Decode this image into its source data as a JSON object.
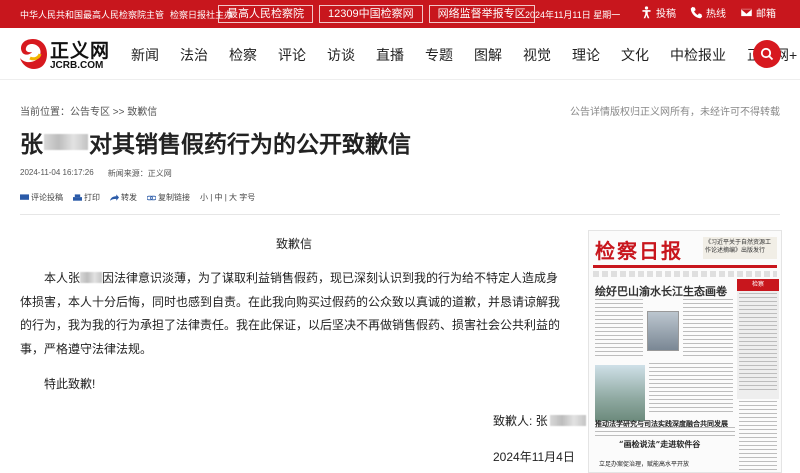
{
  "topbar": {
    "sponsor": "中华人民共和国最高人民检察院主管",
    "publisher": "检察日报社主办",
    "links": [
      "最高人民检察院",
      "12309中国检察网",
      "网络监督举报专区"
    ],
    "date": "2024年11月11日 星期一",
    "actions": [
      {
        "label": "投稿",
        "icon": "accessibility-icon"
      },
      {
        "label": "热线",
        "icon": "phone-icon"
      },
      {
        "label": "邮箱",
        "icon": "mail-icon"
      }
    ]
  },
  "logo": {
    "name": "正义网",
    "domain": "JCRB.COM"
  },
  "nav": [
    "新闻",
    "法治",
    "检察",
    "评论",
    "访谈",
    "直播",
    "专题",
    "图解",
    "视觉",
    "理论",
    "文化",
    "中检报业",
    "正义网+"
  ],
  "article": {
    "breadcrumb": "当前位置：公告专区 >> 致歉信",
    "copyright": "公告详情版权归正义网所有，未经许可不得转载",
    "title_prefix": "张",
    "title_suffix": "对其销售假药行为的公开致歉信",
    "time": "2024-11-04 16:17:26",
    "source": "新闻来源：正义网",
    "tools": [
      "评论投稿",
      "打印",
      "转发",
      "复制链接"
    ],
    "font_size_label": "小 | 中 | 大 字号"
  },
  "letter": {
    "heading": "致歉信",
    "body_start": "本人张",
    "body_rest": "因法律意识淡薄，为了谋取利益销售假药，现已深刻认识到我的行为给不特定人造成身体损害，本人十分后悔，同时也感到自责。在此我向购买过假药的公众致以真诚的道歉，并恳请谅解我的行为，我为我的行为承担了法律责任。我在此保证，以后坚决不再做销售假药、损害社会公共利益的事，严格遵守法律法规。",
    "closing": "特此致歉!",
    "signature": "致歉人: 张",
    "date": "2024年11月4日"
  },
  "newspaper": {
    "masthead": "检察日报",
    "side_text": "《习近平关于自然资源工作论述摘编》出版发行",
    "headline": "绘好巴山渝水长江生态画卷",
    "vertical_text": "检察",
    "headline2": "推动法学研究与司法实践深度融合共同发展",
    "headline3": "“画检说法”走进软件谷",
    "headline4": "立足办案促治理，赋能高水平开放"
  }
}
